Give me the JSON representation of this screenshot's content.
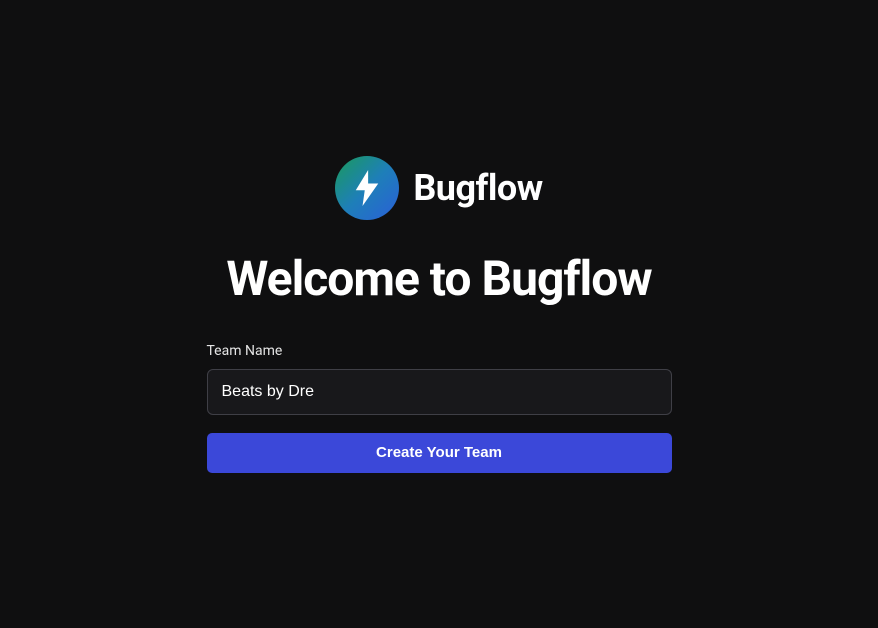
{
  "brand": {
    "name": "Bugflow"
  },
  "heading": "Welcome to Bugflow",
  "form": {
    "team_name_label": "Team Name",
    "team_name_value": "Beats by Dre",
    "submit_label": "Create Your Team"
  }
}
